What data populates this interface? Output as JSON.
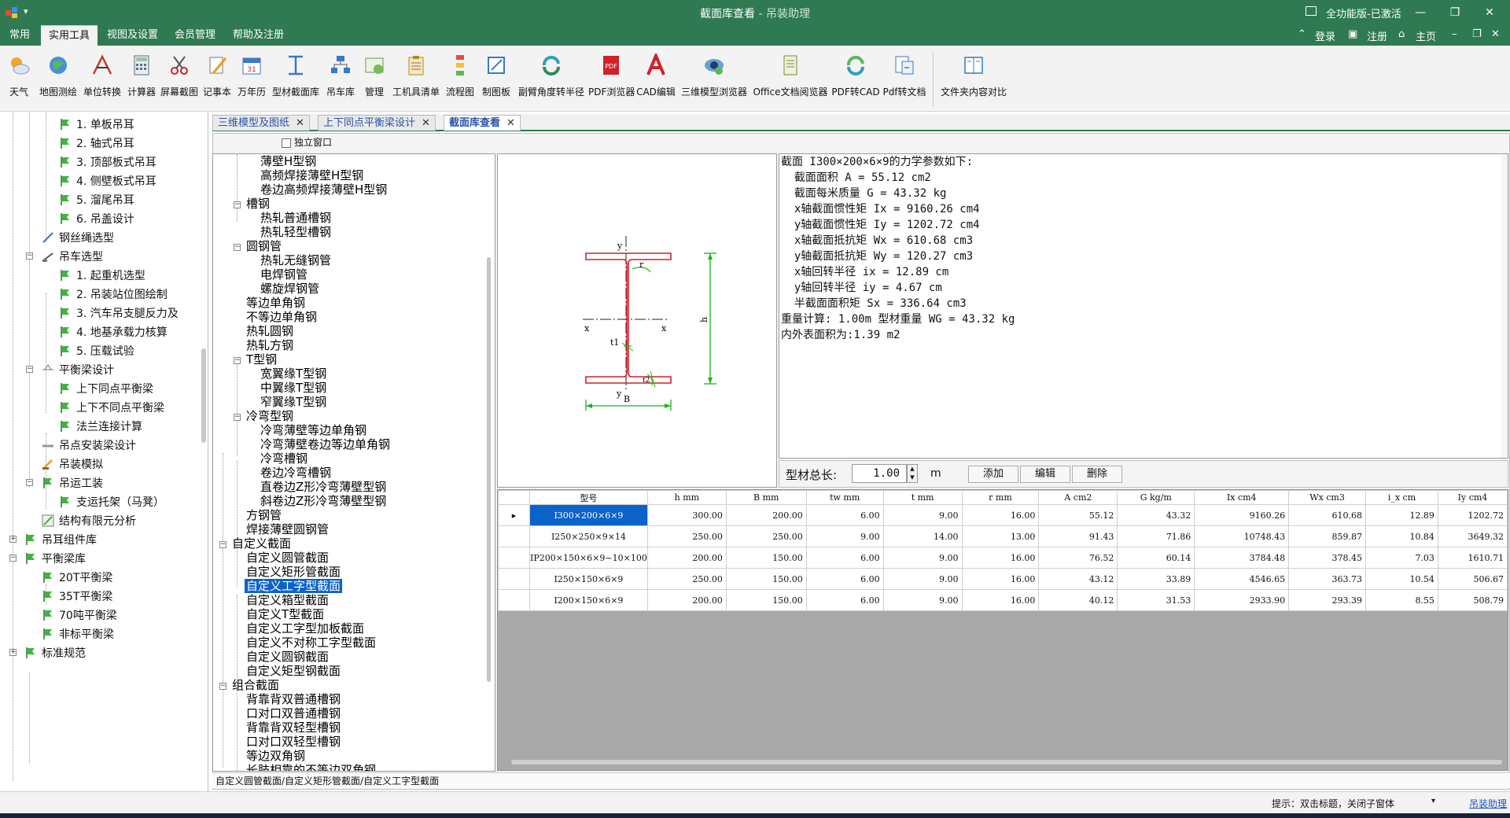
{
  "window": {
    "title": "截面库查看",
    "subtitle": "- 吊装助理",
    "license": "全功能版-已激活",
    "min": "—",
    "restore": "❐",
    "close": "✕"
  },
  "menu": {
    "tabs": [
      "常用",
      "实用工具",
      "视图及设置",
      "会员管理",
      "帮助及注册"
    ],
    "active": 1,
    "right": {
      "login": "登录",
      "register": "注册",
      "home": "主页"
    }
  },
  "toolbar": [
    {
      "label": "天气",
      "icon": "weather-icon"
    },
    {
      "label": "地图测绘",
      "icon": "map-icon"
    },
    {
      "label": "单位转换",
      "icon": "unit-convert-icon"
    },
    {
      "label": "计算器",
      "icon": "calculator-icon"
    },
    {
      "label": "屏幕截图",
      "icon": "scissors-icon"
    },
    {
      "label": "记事本",
      "icon": "notepad-icon"
    },
    {
      "label": "万年历",
      "icon": "calendar-icon"
    },
    {
      "label": "型材截面库",
      "icon": "section-library-icon"
    },
    {
      "label": "吊车库",
      "icon": "crane-library-icon"
    },
    {
      "label": "管理",
      "icon": "manage-icon"
    },
    {
      "label": "工机具清单",
      "icon": "clipboard-icon"
    },
    {
      "label": "流程图",
      "icon": "flowchart-icon"
    },
    {
      "label": "制图板",
      "icon": "drawing-board-icon"
    },
    {
      "label": "副臂角度转半径",
      "icon": "rotate-icon"
    },
    {
      "label": "PDF浏览器",
      "icon": "pdf-icon"
    },
    {
      "label": "CAD编辑",
      "icon": "cad-icon"
    },
    {
      "label": "三维模型浏览器",
      "icon": "3d-model-icon"
    },
    {
      "label": "Office文档阅览器",
      "icon": "office-doc-icon"
    },
    {
      "label": "PDF转CAD",
      "icon": "pdf-to-cad-icon"
    },
    {
      "label": "Pdf转文档",
      "icon": "pdf-to-doc-icon"
    },
    {
      "label": "文件夹内容对比",
      "icon": "folder-compare-icon"
    }
  ],
  "left_tree": [
    {
      "label": "1. 单板吊耳"
    },
    {
      "label": "2. 轴式吊耳"
    },
    {
      "label": "3. 顶部板式吊耳"
    },
    {
      "label": "4. 侧壁板式吊耳"
    },
    {
      "label": "5. 溜尾吊耳"
    },
    {
      "label": "6. 吊盖设计"
    },
    {
      "label": "钢丝绳选型"
    },
    {
      "label": "吊车选型"
    },
    {
      "label": "1. 起重机选型"
    },
    {
      "label": "2. 吊装站位图绘制"
    },
    {
      "label": "3. 汽车吊支腿反力及"
    },
    {
      "label": "4. 地基承载力核算"
    },
    {
      "label": "5. 压载试验"
    },
    {
      "label": "平衡梁设计"
    },
    {
      "label": "上下同点平衡梁"
    },
    {
      "label": "上下不同点平衡梁"
    },
    {
      "label": "法兰连接计算"
    },
    {
      "label": "吊点安装梁设计"
    },
    {
      "label": "吊装模拟"
    },
    {
      "label": "吊运工装"
    },
    {
      "label": "支运托架（马凳）"
    },
    {
      "label": "结构有限元分析"
    },
    {
      "label": "吊耳组件库"
    },
    {
      "label": "平衡梁库"
    },
    {
      "label": "20T平衡梁"
    },
    {
      "label": "35T平衡梁"
    },
    {
      "label": "70吨平衡梁"
    },
    {
      "label": "非标平衡梁"
    },
    {
      "label": "标准规范"
    }
  ],
  "doc_tabs": [
    {
      "label": "三维模型及图纸",
      "close": "✕"
    },
    {
      "label": "上下同点平衡梁设计",
      "close": "✕"
    },
    {
      "label": "截面库查看",
      "close": "✕"
    }
  ],
  "independent_window": "独立窗口",
  "section_tree": [
    "薄壁H型钢",
    "高频焊接薄壁H型钢",
    "卷边高频焊接薄壁H型钢",
    "槽钢",
    "热轧普通槽钢",
    "热轧轻型槽钢",
    "圆钢管",
    "热轧无缝钢管",
    "电焊钢管",
    "螺旋焊钢管",
    "等边单角钢",
    "不等边单角钢",
    "热轧圆钢",
    "热轧方钢",
    "T型钢",
    "宽翼缘T型钢",
    "中翼缘T型钢",
    "窄翼缘T型钢",
    "冷弯型钢",
    "冷弯薄壁等边单角钢",
    "冷弯薄壁卷边等边单角钢",
    "冷弯槽钢",
    "卷边冷弯槽钢",
    "直卷边Z形冷弯薄壁型钢",
    "斜卷边Z形冷弯薄壁型钢",
    "方钢管",
    "焊接薄壁圆钢管",
    "自定义截面",
    "自定义圆管截面",
    "自定义矩形管截面",
    "自定义工字型截面",
    "自定义箱型截面",
    "自定义T型截面",
    "自定义工字型加板截面",
    "自定义不对称工字型截面",
    "自定义圆钢截面",
    "自定义矩型钢截面",
    "组合截面",
    "背靠背双普通槽钢",
    "口对口双普通槽钢",
    "背靠背双轻型槽钢",
    "口对口双轻型槽钢",
    "等边双角钢",
    "长肢相靠的不等边双角钢"
  ],
  "section_selected": "自定义工字型截面",
  "drawing_labels": {
    "y_top": "y",
    "y_bottom": "y",
    "x_left": "x",
    "x_right": "x",
    "r": "r",
    "t1": "t1",
    "t2": "t2",
    "h": "h",
    "B": "B"
  },
  "params": [
    "截面 I300×200×6×9的力学参数如下:",
    "  截面面积 A = 55.12 cm2",
    "  截面每米质量 G = 43.32 kg",
    "  x轴截面惯性矩 Ix = 9160.26 cm4",
    "  y轴截面惯性矩 Iy = 1202.72 cm4",
    "  x轴截面抵抗矩 Wx = 610.68 cm3",
    "  y轴截面抵抗矩 Wy = 120.27 cm3",
    "  x轴回转半径 ix = 12.89 cm",
    "  y轴回转半径 iy = 4.67 cm",
    "  半截面面积矩 Sx = 336.64 cm3",
    "重量计算: 1.00m 型材重量 WG = 43.32 kg",
    "内外表面积为:1.39 m2"
  ],
  "length": {
    "label": "型材总长:",
    "value": "1.00",
    "unit": "m",
    "spin_up": "▲",
    "spin_down": "▼"
  },
  "buttons": {
    "add": "添加",
    "edit": "编辑",
    "delete": "删除"
  },
  "grid": {
    "columns": [
      "型号",
      "h mm",
      "B mm",
      "tw mm",
      "t mm",
      "r mm",
      "A cm2",
      "G kg/m",
      "Ix cm4",
      "Wx cm3",
      "i_x cm",
      "Iy cm4"
    ],
    "rows": [
      [
        "I300×200×6×9",
        "300.00",
        "200.00",
        "6.00",
        "9.00",
        "16.00",
        "55.12",
        "43.32",
        "9160.26",
        "610.68",
        "12.89",
        "1202.72"
      ],
      [
        "I250×250×9×14",
        "250.00",
        "250.00",
        "9.00",
        "14.00",
        "13.00",
        "91.43",
        "71.86",
        "10748.43",
        "859.87",
        "10.84",
        "3649.32"
      ],
      [
        "IP200×150×6×9~10×100",
        "200.00",
        "150.00",
        "6.00",
        "9.00",
        "16.00",
        "76.52",
        "60.14",
        "3784.48",
        "378.45",
        "7.03",
        "1610.71"
      ],
      [
        "I250×150×6×9",
        "250.00",
        "150.00",
        "6.00",
        "9.00",
        "16.00",
        "43.12",
        "33.89",
        "4546.65",
        "363.73",
        "10.54",
        "506.67"
      ],
      [
        "I200×150×6×9",
        "200.00",
        "150.00",
        "6.00",
        "9.00",
        "16.00",
        "40.12",
        "31.53",
        "2933.90",
        "293.39",
        "8.55",
        "508.79"
      ]
    ],
    "current_row_marker": "▸"
  },
  "path_text": "自定义圆管截面/自定义矩形管截面/自定义工字型截面",
  "status": {
    "hint": "提示：双击标题，关闭子窗体",
    "hint_arrow": "▾",
    "help": "吊装助理"
  },
  "colors": {
    "titlebar": "#2f7a52",
    "selection": "#0a63c8",
    "tab_text": "#2c52a8",
    "section_red": "#d0202a",
    "dimension_green": "#18b818"
  }
}
